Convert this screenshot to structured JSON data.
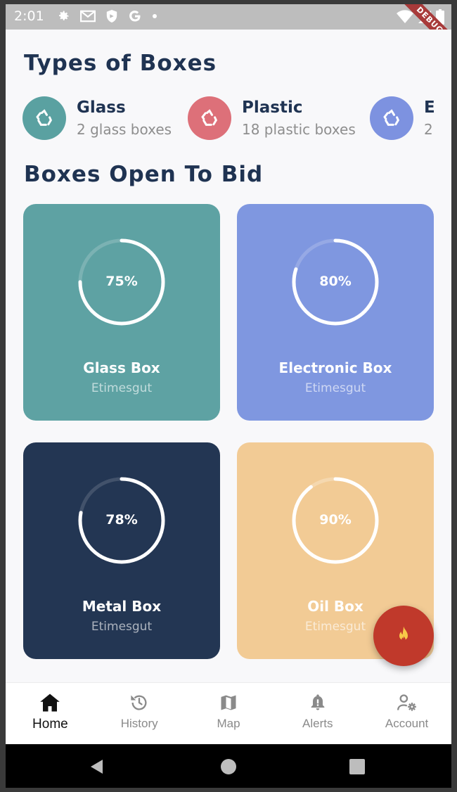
{
  "status_bar": {
    "time": "2:01",
    "debug_label": "DEBUG",
    "icons_left": [
      "gear-icon",
      "mail-icon",
      "shield-icon",
      "google-icon",
      "dot-icon"
    ],
    "icons_right": [
      "wifi-icon",
      "signal-icon",
      "battery-icon"
    ]
  },
  "sections": {
    "types_title": "Types of Boxes",
    "boxes_title": "Boxes Open To Bid"
  },
  "types": [
    {
      "name": "Glass",
      "count": "2 glass boxes",
      "color": "#5aa1a1",
      "icon": "recycle-icon"
    },
    {
      "name": "Plastic",
      "count": "18 plastic boxes",
      "color": "#dd7079",
      "icon": "recycle-icon"
    },
    {
      "name": "E",
      "count": "2",
      "color": "#7d92e0",
      "icon": "recycle-icon"
    }
  ],
  "boxes": [
    {
      "name": "Glass Box",
      "location": "Etimesgut",
      "percent_label": "75%",
      "progress": 0.75,
      "color": "#5ea2a3"
    },
    {
      "name": "Electronic Box",
      "location": "Etimesgut",
      "percent_label": "80%",
      "progress": 0.8,
      "color": "#7f97e0"
    },
    {
      "name": "Metal Box",
      "location": "Etimesgut",
      "percent_label": "78%",
      "progress": 0.78,
      "color": "#233653"
    },
    {
      "name": "Oil Box",
      "location": "Etimesgut",
      "percent_label": "90%",
      "progress": 0.9,
      "color": "#f2cb95"
    }
  ],
  "fab": {
    "icon": "fire-icon",
    "color": "#c0392b"
  },
  "nav": {
    "items": [
      {
        "label": "Home",
        "icon": "home-icon",
        "active": true
      },
      {
        "label": "History",
        "icon": "history-icon",
        "active": false
      },
      {
        "label": "Map",
        "icon": "map-icon",
        "active": false
      },
      {
        "label": "Alerts",
        "icon": "bell-icon",
        "active": false
      },
      {
        "label": "Account",
        "icon": "account-settings-icon",
        "active": false
      }
    ]
  },
  "android_nav": [
    "back-icon",
    "home-circle-icon",
    "recents-icon"
  ]
}
